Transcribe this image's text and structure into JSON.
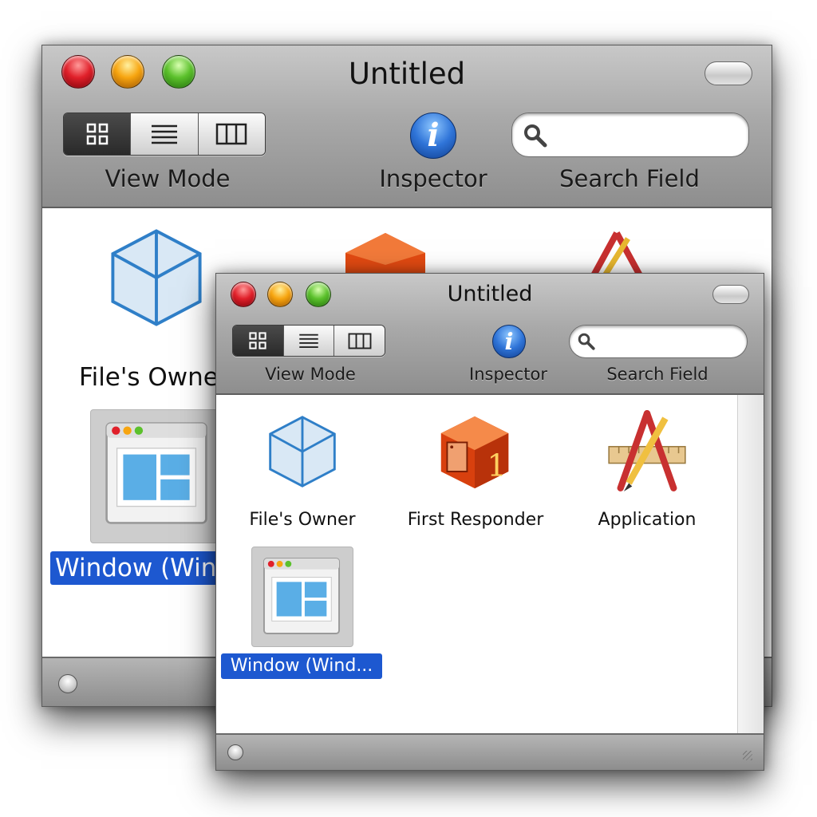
{
  "window_title": "Untitled",
  "toolbar": {
    "view_mode_label": "View Mode",
    "inspector_label": "Inspector",
    "search_label": "Search Field",
    "inspector_glyph": "i",
    "search_value": "",
    "view_modes": [
      "icon-view",
      "list-view",
      "column-view"
    ],
    "selected_view_mode": "icon-view"
  },
  "background_window": {
    "items": [
      {
        "label": "File's Owne",
        "icon": "cube-icon"
      },
      {
        "label": "Window (Win",
        "icon": "window-icon",
        "selected": true
      }
    ]
  },
  "front_window": {
    "items": [
      {
        "label": "File's Owner",
        "icon": "cube-icon"
      },
      {
        "label": "First Responder",
        "icon": "first-responder-icon"
      },
      {
        "label": "Application",
        "icon": "application-icon"
      },
      {
        "label": "Window (Wind...",
        "icon": "window-icon",
        "selected": true
      }
    ]
  },
  "colors": {
    "selection": "#1d58d0",
    "cube": "#2f7fc8",
    "first_responder": "#e24a12"
  }
}
